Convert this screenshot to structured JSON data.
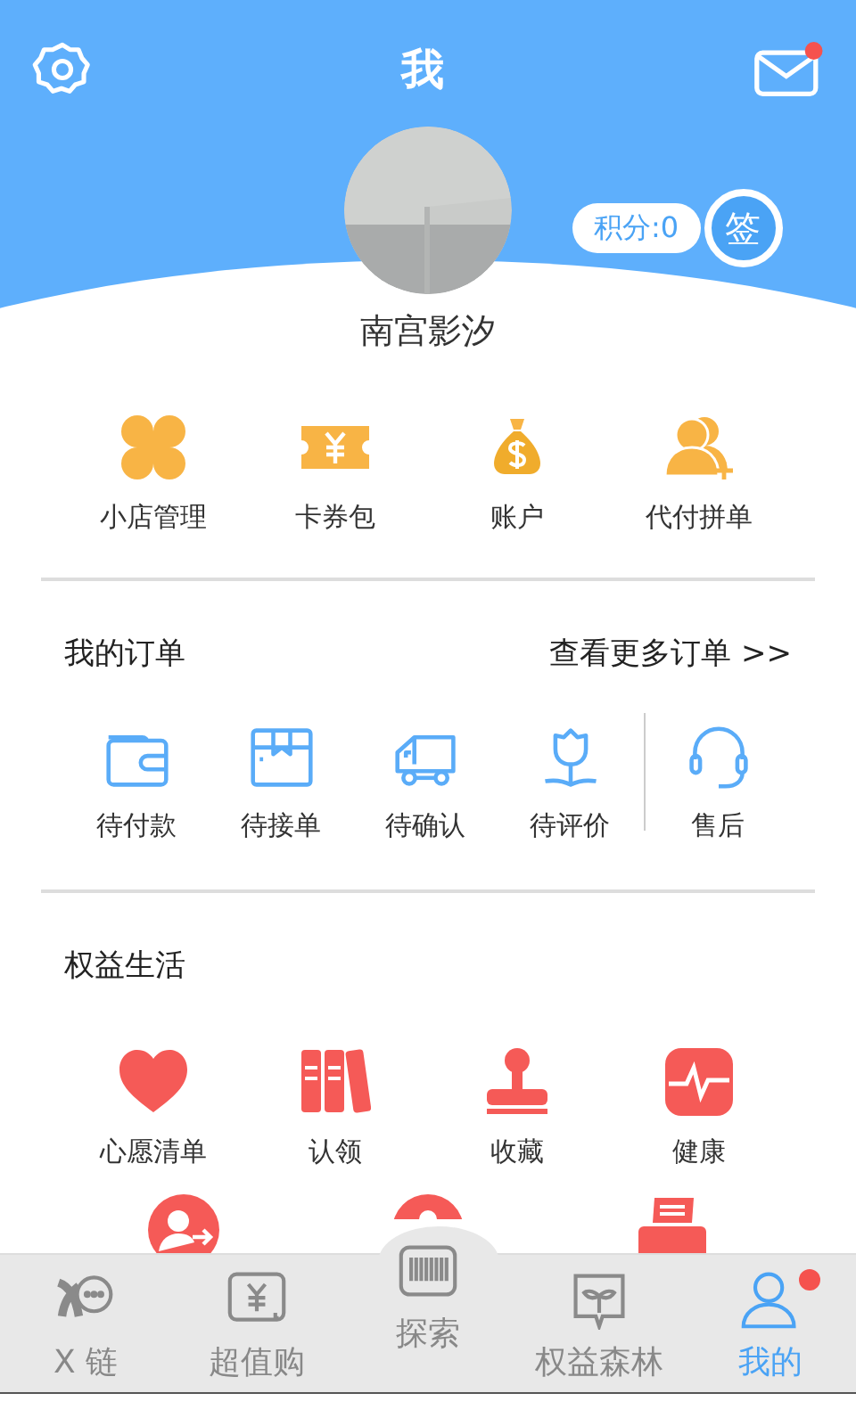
{
  "header": {
    "title": "我",
    "mail_unread": true
  },
  "profile": {
    "name": "南宫影汐",
    "points": "积分:0",
    "sign_in": "签"
  },
  "quick_actions": [
    {
      "label": "小店管理"
    },
    {
      "label": "卡券包"
    },
    {
      "label": "账户"
    },
    {
      "label": "代付拼单"
    }
  ],
  "orders": {
    "title": "我的订单",
    "more_link": "查看更多订单 >>",
    "items": [
      {
        "label": "待付款"
      },
      {
        "label": "待接单"
      },
      {
        "label": "待确认"
      },
      {
        "label": "待评价"
      },
      {
        "label": "售后"
      }
    ]
  },
  "benefits": {
    "title": "权益生活",
    "items": [
      {
        "label": "心愿清单"
      },
      {
        "label": "认领"
      },
      {
        "label": "收藏"
      },
      {
        "label": "健康"
      }
    ]
  },
  "tab_bar": [
    {
      "label": "X 链",
      "selected": false,
      "badge": false
    },
    {
      "label": "超值购",
      "selected": false,
      "badge": false
    },
    {
      "label": "探索",
      "selected": false,
      "badge": false
    },
    {
      "label": "权益森林",
      "selected": false,
      "badge": false
    },
    {
      "label": "我的",
      "selected": true,
      "badge": true
    }
  ]
}
